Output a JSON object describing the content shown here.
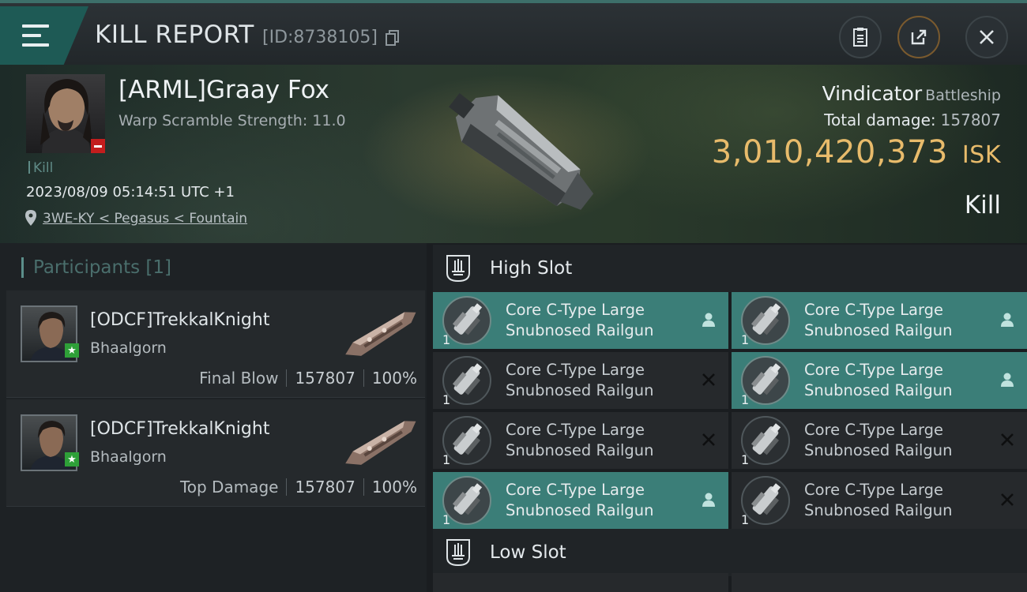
{
  "header": {
    "title": "KILL REPORT",
    "report_id": "[ID:8738105]"
  },
  "victim": {
    "name": "[ARML]Graay Fox",
    "subtitle": "Warp Scramble Strength: 11.0",
    "kill_tag": "Kill",
    "timestamp": "2023/08/09 05:14:51 UTC +1",
    "location": "3WE-KY < Pegasus < Fountain",
    "ship_name": "Vindicator",
    "ship_class": "Battleship",
    "total_damage_label": "Total damage:",
    "total_damage_value": "157807",
    "isk_value": "3,010,420,373",
    "isk_unit": "ISK",
    "result": "Kill"
  },
  "participants": {
    "title": "Participants [1]",
    "rows": [
      {
        "name": "[ODCF]TrekkalKnight",
        "ship": "Bhaalgorn",
        "role": "Final Blow",
        "damage": "157807",
        "percent": "100%"
      },
      {
        "name": "[ODCF]TrekkalKnight",
        "ship": "Bhaalgorn",
        "role": "Top Damage",
        "damage": "157807",
        "percent": "100%"
      }
    ]
  },
  "slots": {
    "high_label": "High Slot",
    "low_label": "Low Slot",
    "high_modules": [
      {
        "line1": "Core C-Type Large",
        "line2": "Snubnosed Railgun",
        "qty": "1",
        "status": "person",
        "state": "on"
      },
      {
        "line1": "Core C-Type Large",
        "line2": "Snubnosed Railgun",
        "qty": "1",
        "status": "person",
        "state": "on"
      },
      {
        "line1": "Core C-Type Large",
        "line2": "Snubnosed Railgun",
        "qty": "1",
        "status": "x",
        "state": "off"
      },
      {
        "line1": "Core C-Type Large",
        "line2": "Snubnosed Railgun",
        "qty": "1",
        "status": "person",
        "state": "on"
      },
      {
        "line1": "Core C-Type Large",
        "line2": "Snubnosed Railgun",
        "qty": "1",
        "status": "x",
        "state": "off"
      },
      {
        "line1": "Core C-Type Large",
        "line2": "Snubnosed Railgun",
        "qty": "1",
        "status": "x",
        "state": "off"
      },
      {
        "line1": "Core C-Type Large",
        "line2": "Snubnosed Railgun",
        "qty": "1",
        "status": "person",
        "state": "on"
      },
      {
        "line1": "Core C-Type Large",
        "line2": "Snubnosed Railgun",
        "qty": "1",
        "status": "x",
        "state": "off"
      }
    ]
  },
  "colors": {
    "accent_teal": "#3b7e78",
    "isk_gold": "#e8bb6b",
    "danger_red": "#c31d1d",
    "friendly_green": "#2ea038"
  }
}
